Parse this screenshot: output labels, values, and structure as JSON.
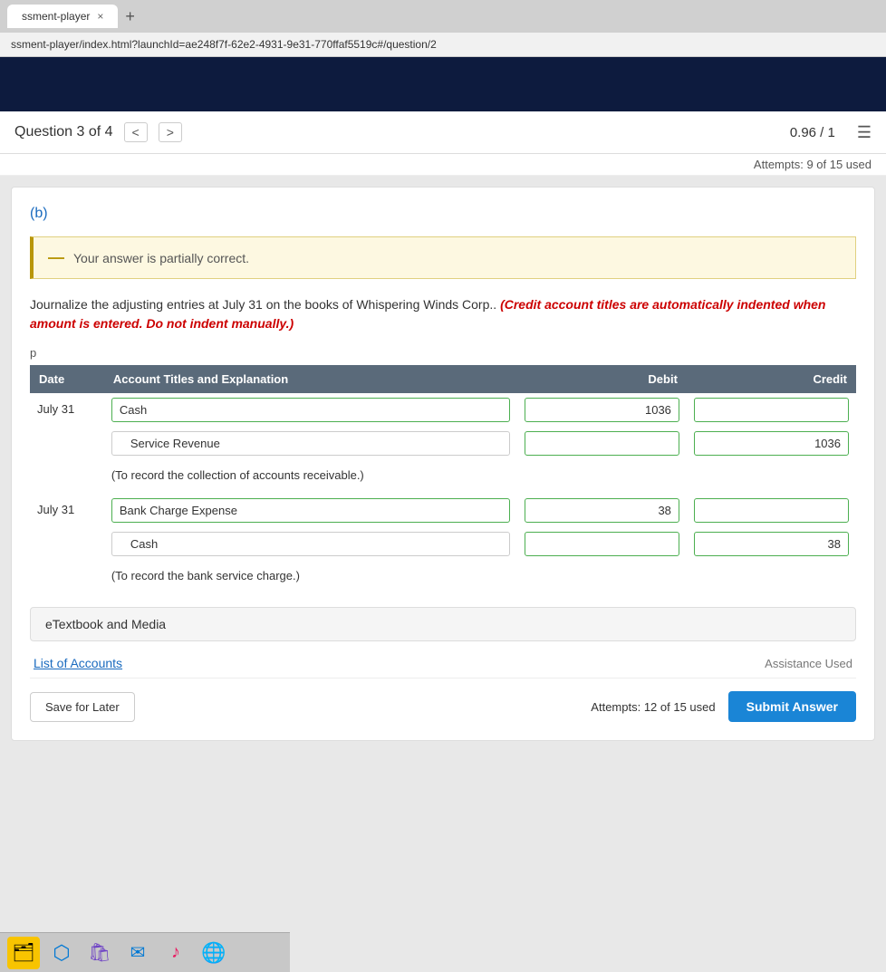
{
  "browser": {
    "tab_label": "×",
    "new_tab": "+",
    "address_bar": "ssment-player/index.html?launchId=ae248f7f-62e2-4931-9e31-770ffaf5519c#/question/2"
  },
  "question_header": {
    "title": "Question 3 of 4",
    "nav_prev": "<",
    "nav_next": ">",
    "score": "0.96 / 1"
  },
  "attempts_notice": "Attempts: 9 of 15 used",
  "section_label": "(b)",
  "banner": {
    "icon": "—",
    "message": "Your answer is partially correct."
  },
  "instructions": {
    "main": "Journalize the adjusting entries at July 31 on the books of Whispering Winds Corp..",
    "red_italic": "(Credit account titles are automatically indented when amount is entered. Do not indent manually.)"
  },
  "p_label": "p",
  "table": {
    "headers": [
      "Date",
      "Account Titles and Explanation",
      "Debit",
      "Credit"
    ],
    "rows": [
      {
        "date": "July 31",
        "entries": [
          {
            "account": "Cash",
            "debit": "1036",
            "credit": "",
            "indent": false
          },
          {
            "account": "Service Revenue",
            "debit": "",
            "credit": "1036",
            "indent": true
          }
        ],
        "note": "(To record the collection of accounts receivable.)"
      },
      {
        "date": "July 31",
        "entries": [
          {
            "account": "Bank Charge Expense",
            "debit": "38",
            "credit": "",
            "indent": false
          },
          {
            "account": "Cash",
            "debit": "",
            "credit": "38",
            "indent": true
          }
        ],
        "note": "(To record the bank service charge.)"
      }
    ]
  },
  "etextbook": "eTextbook and Media",
  "list_accounts_label": "List of Accounts",
  "assistance_label": "Assistance Used",
  "save_later_label": "Save for Later",
  "attempts_bottom": "Attempts: 12 of 15 used",
  "submit_label": "Submit Answer",
  "taskbar": {
    "icons": [
      "🗂",
      "🌐",
      "🛍",
      "✉",
      "♪",
      "🌐"
    ]
  }
}
